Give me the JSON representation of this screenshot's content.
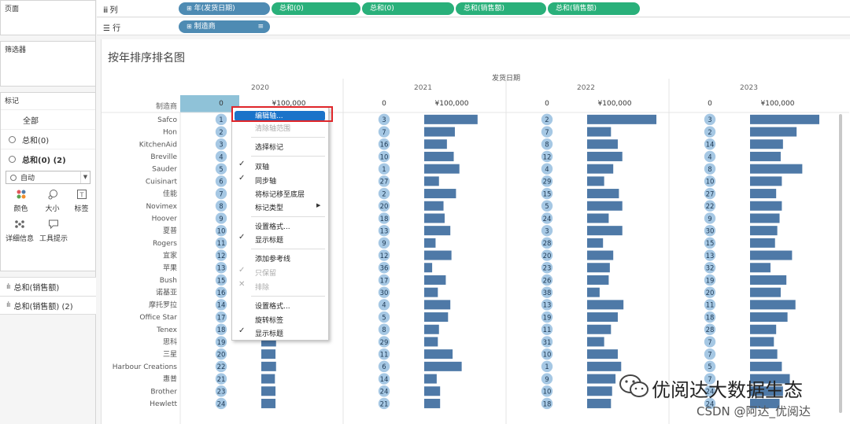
{
  "left_panel": {
    "pages_label": "页面",
    "filters_label": "筛选器",
    "marks_label": "标记",
    "marks_rows": [
      "全部",
      "总和(0)",
      "总和(0) (2)"
    ],
    "mark_type": "自动",
    "mark_buttons": [
      "颜色",
      "大小",
      "标签",
      "详细信息",
      "工具提示"
    ],
    "measures": [
      "总和(销售额)",
      "总和(销售额) (2)"
    ]
  },
  "columns_shelf": {
    "label": "列",
    "pills": [
      "年(发货日期)",
      "总和(0)",
      "总和(0)",
      "总和(销售额)",
      "总和(销售额)"
    ]
  },
  "rows_shelf": {
    "label": "行",
    "pills": [
      "制造商"
    ]
  },
  "view": {
    "title": "按年排序排名图",
    "column_header": "发货日期",
    "row_header": "制造商",
    "axis_zero": "0",
    "axis_money": "¥100,000"
  },
  "colors": {
    "bar": "#4e79a7",
    "circle": "#a6c8e4",
    "dimension_pill": "#4e8bb3",
    "measure_pill": "#29b07a",
    "highlight": "#1b73c9",
    "red_box": "#e0262a"
  },
  "context_menu": {
    "items": [
      "编辑轴...",
      "清除轴范围",
      "选择标记",
      "双轴",
      "同步轴",
      "将标记移至底层",
      "标记类型",
      "设置格式...",
      "显示标题",
      "添加参考线",
      "只保留",
      "排除",
      "设置格式...",
      "旋转标签",
      "显示标题"
    ]
  },
  "watermark": {
    "brand": "优阅达大数据生态",
    "credit": "CSDN @阿达_优阅达"
  },
  "chart_data": {
    "type": "bar",
    "title": "按年排序排名图",
    "column_header": "发货日期",
    "row_header": "制造商",
    "categories": [
      "Safco",
      "Hon",
      "KitchenAid",
      "Breville",
      "Sauder",
      "Cuisinart",
      "佳能",
      "Novimex",
      "Hoover",
      "夏普",
      "Rogers",
      "宜家",
      "苹果",
      "Bush",
      "诺基亚",
      "摩托罗拉",
      "Office Star",
      "Tenex",
      "思科",
      "三星",
      "Harbour Creations",
      "惠普",
      "Brother",
      "Hewlett"
    ],
    "series": [
      {
        "name": "2020",
        "rank": [
          1,
          2,
          3,
          4,
          5,
          6,
          7,
          8,
          9,
          10,
          11,
          12,
          13,
          15,
          16,
          14,
          17,
          18,
          19,
          20,
          22,
          21,
          23,
          24
        ],
        "sales": [
          null,
          null,
          null,
          null,
          null,
          null,
          null,
          null,
          null,
          null,
          null,
          null,
          null,
          null,
          null,
          null,
          null,
          25000,
          26000,
          25000,
          26000,
          24000,
          25000,
          25000
        ]
      },
      {
        "name": "2021",
        "rank": [
          3,
          7,
          16,
          10,
          1,
          27,
          2,
          20,
          18,
          13,
          9,
          12,
          36,
          17,
          30,
          4,
          5,
          8,
          29,
          11,
          6,
          14,
          24,
          21
        ],
        "sales": [
          94000,
          54000,
          40000,
          52000,
          62000,
          26000,
          56000,
          34000,
          36000,
          46000,
          20000,
          48000,
          14000,
          38000,
          24000,
          46000,
          42000,
          26000,
          24000,
          50000,
          66000,
          22000,
          28000,
          28000
        ]
      },
      {
        "name": "2022",
        "rank": [
          2,
          7,
          8,
          12,
          4,
          29,
          15,
          5,
          24,
          3,
          28,
          20,
          23,
          26,
          38,
          13,
          19,
          11,
          31,
          10,
          1,
          9,
          10,
          18
        ],
        "sales": [
          122000,
          42000,
          54000,
          62000,
          46000,
          30000,
          56000,
          62000,
          38000,
          62000,
          28000,
          46000,
          40000,
          38000,
          22000,
          64000,
          54000,
          42000,
          30000,
          54000,
          60000,
          50000,
          44000,
          42000
        ]
      },
      {
        "name": "2023",
        "rank": [
          3,
          2,
          14,
          4,
          8,
          10,
          27,
          22,
          9,
          30,
          15,
          13,
          32,
          19,
          20,
          11,
          18,
          28,
          7,
          7,
          5,
          7,
          24,
          24
        ],
        "sales": [
          122000,
          82000,
          58000,
          54000,
          92000,
          56000,
          46000,
          56000,
          52000,
          48000,
          44000,
          74000,
          36000,
          64000,
          54000,
          80000,
          66000,
          46000,
          42000,
          48000,
          56000,
          70000,
          58000,
          52000
        ]
      }
    ],
    "xlim": [
      0,
      125000
    ],
    "x_tick_labels": [
      "0",
      "¥100,000"
    ]
  }
}
